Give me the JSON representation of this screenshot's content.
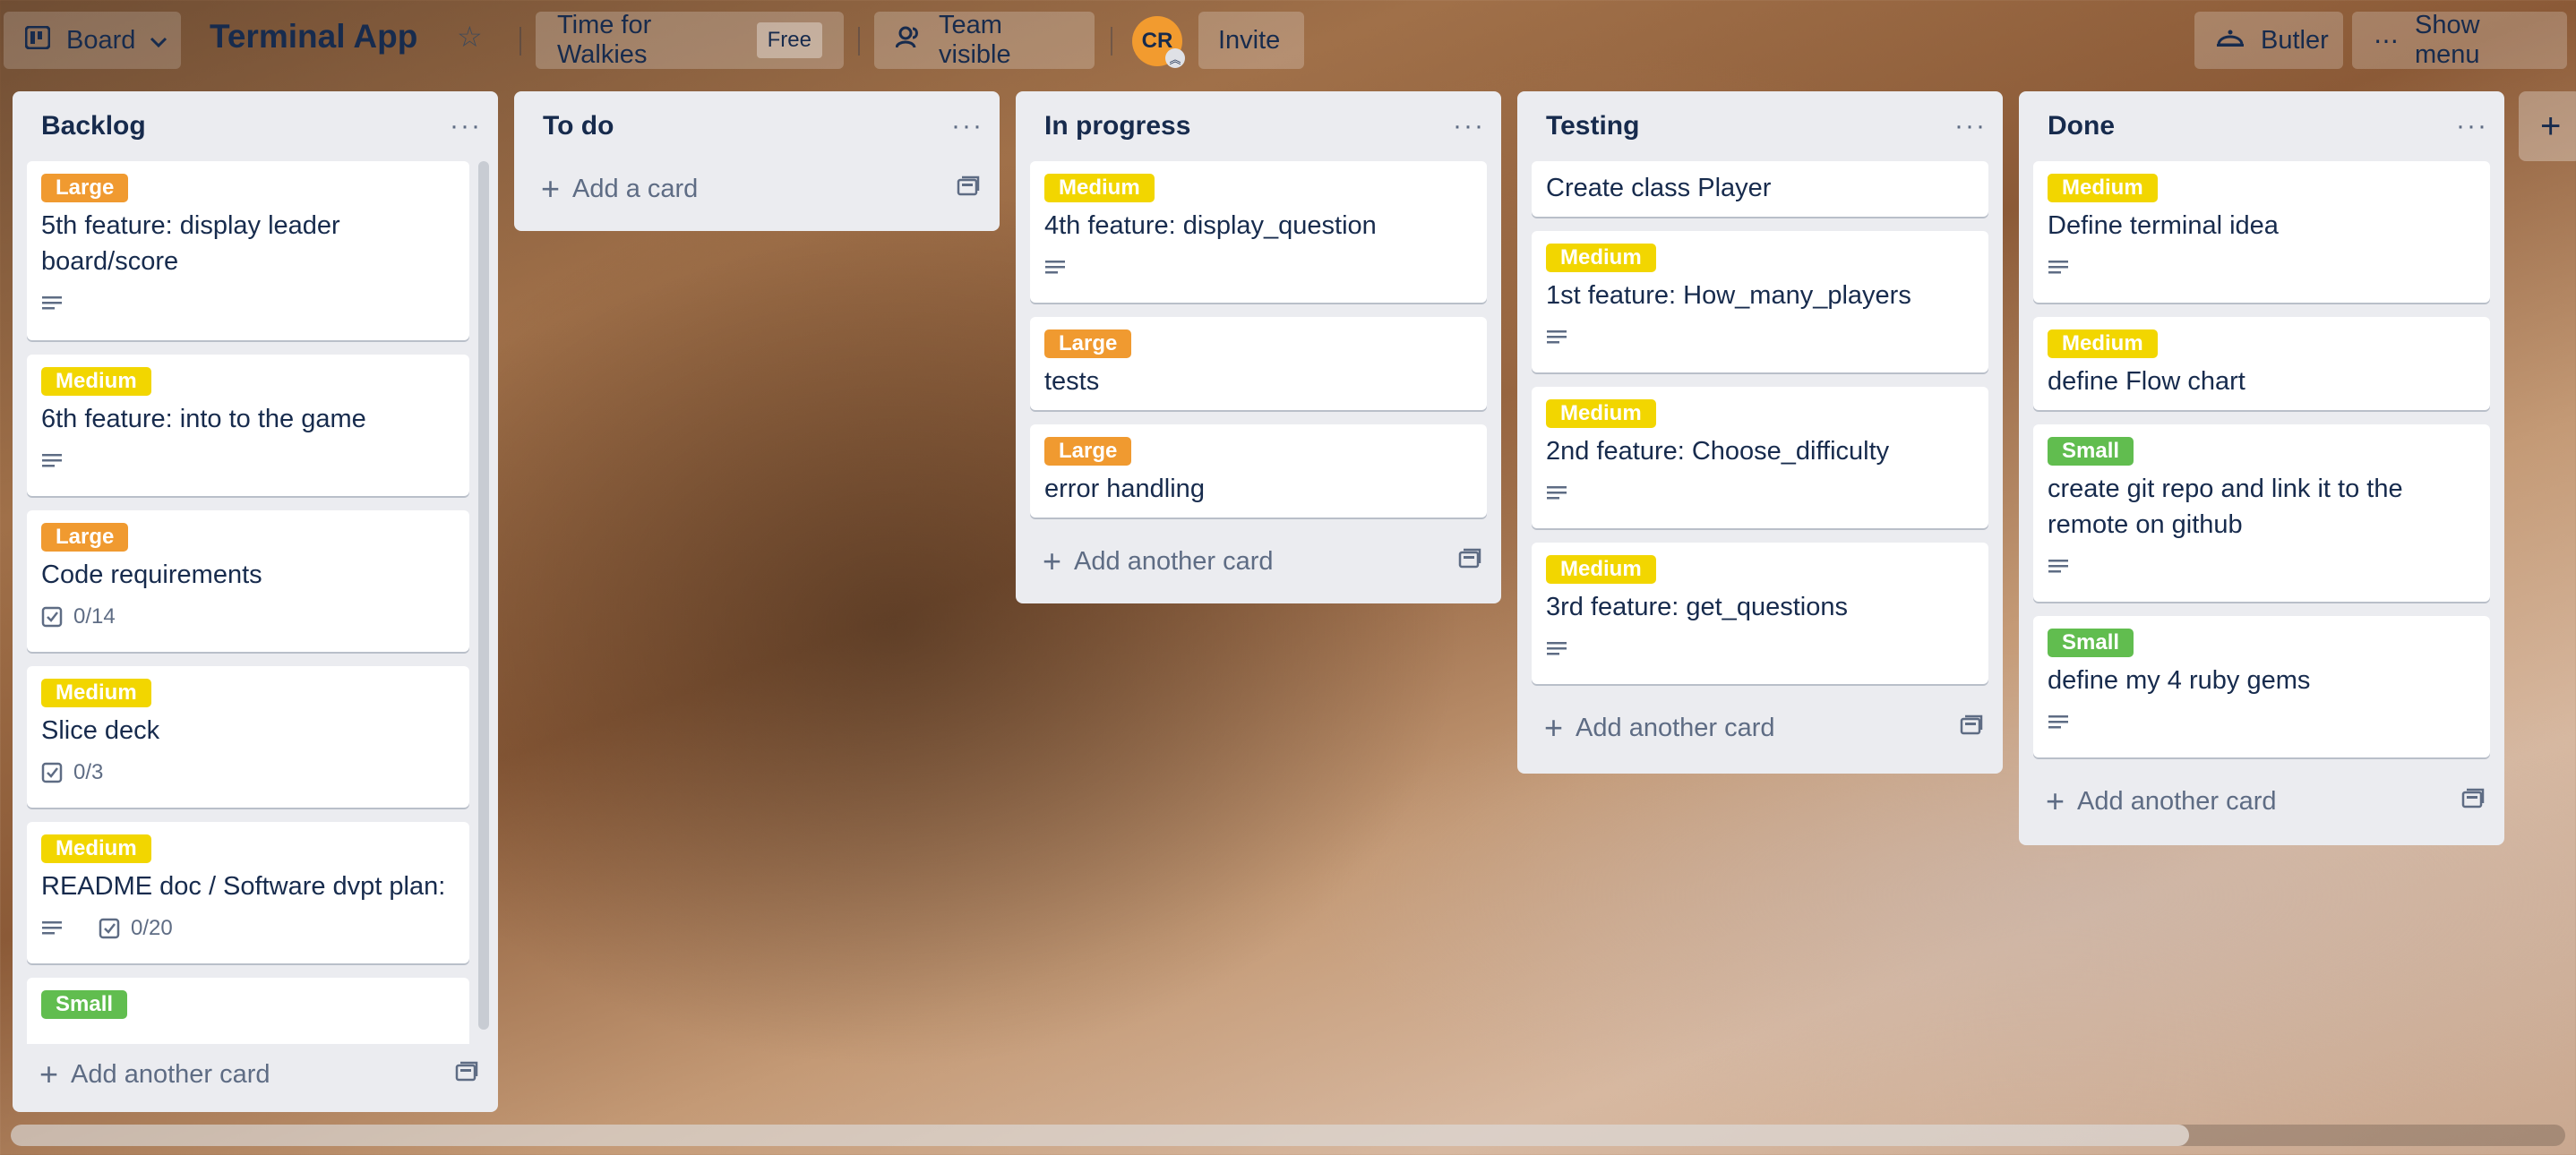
{
  "header": {
    "board_switcher": "Board",
    "board_title": "Terminal App",
    "workspace": "Time for Walkies",
    "plan_badge": "Free",
    "visibility": "Team visible",
    "avatar_initials": "CR",
    "invite": "Invite",
    "butler": "Butler",
    "show_menu": "Show menu"
  },
  "colors": {
    "large": "#f09a30",
    "medium": "#f2d600",
    "small": "#61bd4f"
  },
  "lists": [
    {
      "title": "Backlog",
      "cards": [
        {
          "label": "Large",
          "title": "5th feature: display leader board/score",
          "desc": true
        },
        {
          "label": "Medium",
          "title": "6th feature: into to the game",
          "desc": true
        },
        {
          "label": "Large",
          "title": "Code requirements",
          "checklist": "0/14"
        },
        {
          "label": "Medium",
          "title": "Slice deck",
          "checklist": "0/3"
        },
        {
          "label": "Medium",
          "title": "README doc / Software dvpt plan:",
          "desc": true,
          "checklist": "0/20"
        },
        {
          "label": "Small",
          "title": ""
        }
      ],
      "add_label": "Add another card"
    },
    {
      "title": "To do",
      "cards": [],
      "add_label": "Add a card"
    },
    {
      "title": "In progress",
      "cards": [
        {
          "label": "Medium",
          "title": "4th feature: display_question",
          "desc": true
        },
        {
          "label": "Large",
          "title": "tests"
        },
        {
          "label": "Large",
          "title": "error handling"
        }
      ],
      "add_label": "Add another card"
    },
    {
      "title": "Testing",
      "cards": [
        {
          "label": "",
          "title": "Create class Player"
        },
        {
          "label": "Medium",
          "title": "1st feature: How_many_players",
          "desc": true
        },
        {
          "label": "Medium",
          "title": "2nd feature: Choose_difficulty",
          "desc": true
        },
        {
          "label": "Medium",
          "title": "3rd feature: get_questions",
          "desc": true
        }
      ],
      "add_label": "Add another card"
    },
    {
      "title": "Done",
      "cards": [
        {
          "label": "Medium",
          "title": "Define terminal idea",
          "desc": true
        },
        {
          "label": "Medium",
          "title": "define Flow chart"
        },
        {
          "label": "Small",
          "title": "create git repo and link it to the remote on github",
          "desc": true
        },
        {
          "label": "Small",
          "title": "define my 4 ruby gems",
          "desc": true
        }
      ],
      "add_label": "Add another card"
    }
  ]
}
